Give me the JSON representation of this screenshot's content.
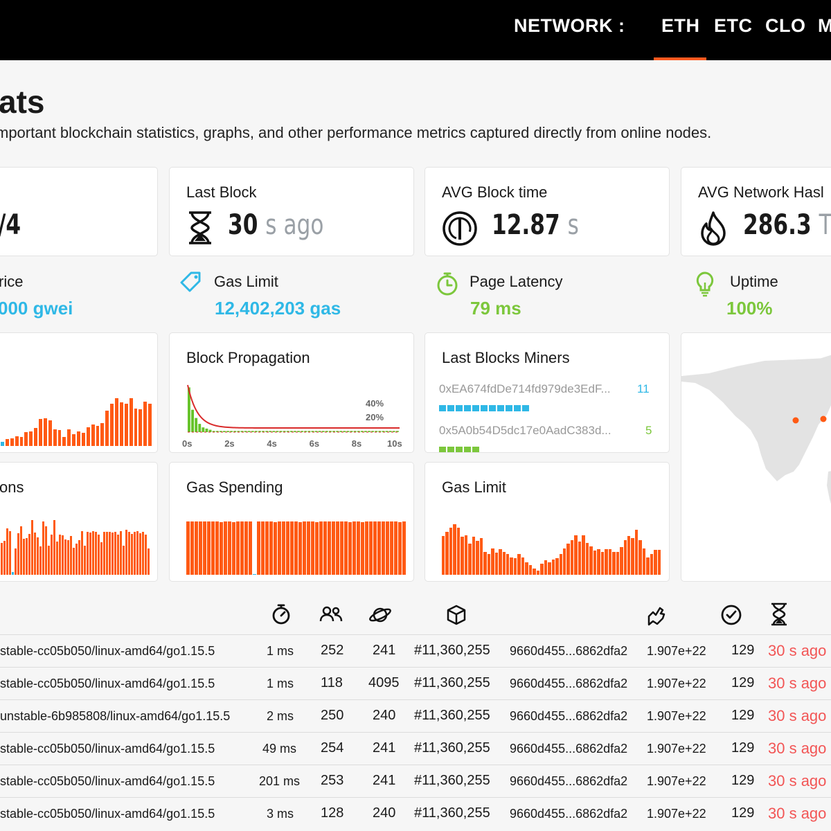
{
  "header": {
    "network_label": "NETWORK :",
    "tabs": [
      "ETH",
      "ETC",
      "CLO",
      "M"
    ],
    "active_tab": "ETH"
  },
  "page": {
    "title": "ats",
    "subtitle": "mportant blockchain statistics, graphs, and other performance metrics captured directly from online nodes."
  },
  "stats": {
    "first": {
      "value": "/4"
    },
    "last_block": {
      "title": "Last Block",
      "value": "30",
      "unit": "s ago",
      "icon": "hourglass-icon"
    },
    "avg_block_time": {
      "title": "AVG Block time",
      "value": "12.87",
      "unit": "s",
      "icon": "gauge-icon"
    },
    "avg_hashrate": {
      "title": "AVG Network Hasl",
      "value": "286.3",
      "unit": "Th",
      "icon": "flame-icon"
    }
  },
  "mini_stats": {
    "gas_price": {
      "label": "rice",
      "value": "000 gwei"
    },
    "gas_limit": {
      "label": "Gas Limit",
      "value": "12,402,203 gas",
      "icon": "tag-icon"
    },
    "page_latency": {
      "label": "Page Latency",
      "value": "79 ms",
      "icon": "stopwatch-icon"
    },
    "uptime": {
      "label": "Uptime",
      "value": "100%",
      "icon": "lightbulb-icon"
    }
  },
  "colors": {
    "accent": "#ff5a14",
    "blue": "#2fb8e6",
    "green": "#7cc73c",
    "red": "#f25555"
  },
  "block_propagation": {
    "title": "Block Propagation",
    "pct_labels": [
      "40%",
      "20%"
    ],
    "x_ticks": [
      "0s",
      "2s",
      "4s",
      "6s",
      "8s",
      "10s"
    ],
    "histogram_pct": [
      38,
      19,
      12,
      7,
      4,
      3,
      2,
      1,
      1,
      1,
      1,
      1,
      1,
      1,
      1,
      1,
      1,
      1,
      1,
      1,
      1,
      1,
      1,
      1,
      1,
      1,
      1,
      1,
      1,
      1,
      1,
      1,
      1,
      1,
      1,
      1,
      1,
      1,
      1,
      1,
      1,
      1,
      1,
      1,
      1,
      1,
      1,
      1,
      1,
      1,
      1,
      1,
      1,
      1,
      1,
      1,
      1,
      1,
      1,
      1
    ]
  },
  "miners": {
    "title": "Last Blocks Miners",
    "list": [
      {
        "address": "0xEA674fdDe714fd979de3EdF...",
        "count": "11",
        "color": "#2fb8e6",
        "blocks": 11
      },
      {
        "address": "0x5A0b54D5dc17e0AadC383d...",
        "count": "5",
        "color": "#7cc73c",
        "blocks": 5
      }
    ]
  },
  "charts": {
    "difficulty_partial": {
      "values": [
        4,
        7,
        8,
        10,
        9,
        14,
        15,
        18,
        27,
        28,
        26,
        17,
        16,
        9,
        17,
        12,
        15,
        13,
        19,
        22,
        20,
        23,
        36,
        43,
        48,
        44,
        43,
        48,
        38,
        37,
        45,
        43
      ]
    },
    "transactions": {
      "title": "ons",
      "values": [
        58,
        61,
        84,
        79,
        5,
        47,
        75,
        88,
        65,
        66,
        74,
        99,
        76,
        67,
        51,
        96,
        88,
        52,
        72,
        99,
        60,
        73,
        71,
        64,
        62,
        70,
        49,
        56,
        63,
        79,
        53,
        78,
        76,
        79,
        78,
        73,
        59,
        77,
        78,
        78,
        76,
        78,
        73,
        79,
        53,
        81,
        77,
        74,
        77,
        79,
        75,
        78,
        72,
        47
      ]
    },
    "gas_spending": {
      "title": "Gas Spending",
      "values": [
        99,
        99,
        99,
        99,
        99,
        99,
        99,
        99,
        98,
        99,
        99,
        98,
        99,
        99,
        99,
        99,
        1,
        99,
        99,
        99,
        99,
        98,
        99,
        99,
        99,
        99,
        99,
        98,
        99,
        99,
        99,
        98,
        99,
        99,
        99,
        99,
        99,
        99,
        99,
        98,
        99,
        99,
        97,
        99,
        99,
        99,
        99,
        99,
        99,
        99,
        99,
        98,
        99
      ]
    },
    "gas_limit_chart": {
      "title": "Gas Limit",
      "values": [
        70,
        78,
        85,
        91,
        85,
        69,
        71,
        56,
        69,
        61,
        66,
        41,
        37,
        48,
        40,
        46,
        41,
        37,
        31,
        30,
        38,
        31,
        23,
        17,
        11,
        8,
        20,
        26,
        23,
        28,
        30,
        38,
        47,
        56,
        62,
        71,
        60,
        71,
        58,
        51,
        44,
        46,
        41,
        46,
        46,
        41,
        41,
        50,
        63,
        70,
        66,
        81,
        63,
        48,
        31,
        37,
        45,
        45
      ]
    }
  },
  "table": {
    "header_icons": [
      "stopwatch-icon",
      "peers-icon",
      "planet-icon",
      "cube-icon",
      "hand-icon",
      "check-circle-icon",
      "hourglass-icon"
    ],
    "rows": [
      {
        "version": "stable-cc05b050/linux-amd64/go1.15.5",
        "latency": "1 ms",
        "peers": "252",
        "pending": "241",
        "block": "#11,360,255",
        "hash": "9660d455...6862dfa2",
        "difficulty": "1.907e+22",
        "txs": "129",
        "time": "30 s ago"
      },
      {
        "version": "stable-cc05b050/linux-amd64/go1.15.5",
        "latency": "1 ms",
        "peers": "118",
        "pending": "4095",
        "block": "#11,360,255",
        "hash": "9660d455...6862dfa2",
        "difficulty": "1.907e+22",
        "txs": "129",
        "time": "30 s ago"
      },
      {
        "version": "unstable-6b985808/linux-amd64/go1.15.5",
        "latency": "2 ms",
        "peers": "250",
        "pending": "240",
        "block": "#11,360,255",
        "hash": "9660d455...6862dfa2",
        "difficulty": "1.907e+22",
        "txs": "129",
        "time": "30 s ago"
      },
      {
        "version": "stable-cc05b050/linux-amd64/go1.15.5",
        "latency": "49 ms",
        "peers": "254",
        "pending": "241",
        "block": "#11,360,255",
        "hash": "9660d455...6862dfa2",
        "difficulty": "1.907e+22",
        "txs": "129",
        "time": "30 s ago"
      },
      {
        "version": "stable-cc05b050/linux-amd64/go1.15.5",
        "latency": "201 ms",
        "peers": "253",
        "pending": "241",
        "block": "#11,360,255",
        "hash": "9660d455...6862dfa2",
        "difficulty": "1.907e+22",
        "txs": "129",
        "time": "30 s ago"
      },
      {
        "version": "stable-cc05b050/linux-amd64/go1.15.5",
        "latency": "3 ms",
        "peers": "128",
        "pending": "240",
        "block": "#11,360,255",
        "hash": "9660d455...6862dfa2",
        "difficulty": "1.907e+22",
        "txs": "129",
        "time": "30 s ago"
      }
    ]
  }
}
